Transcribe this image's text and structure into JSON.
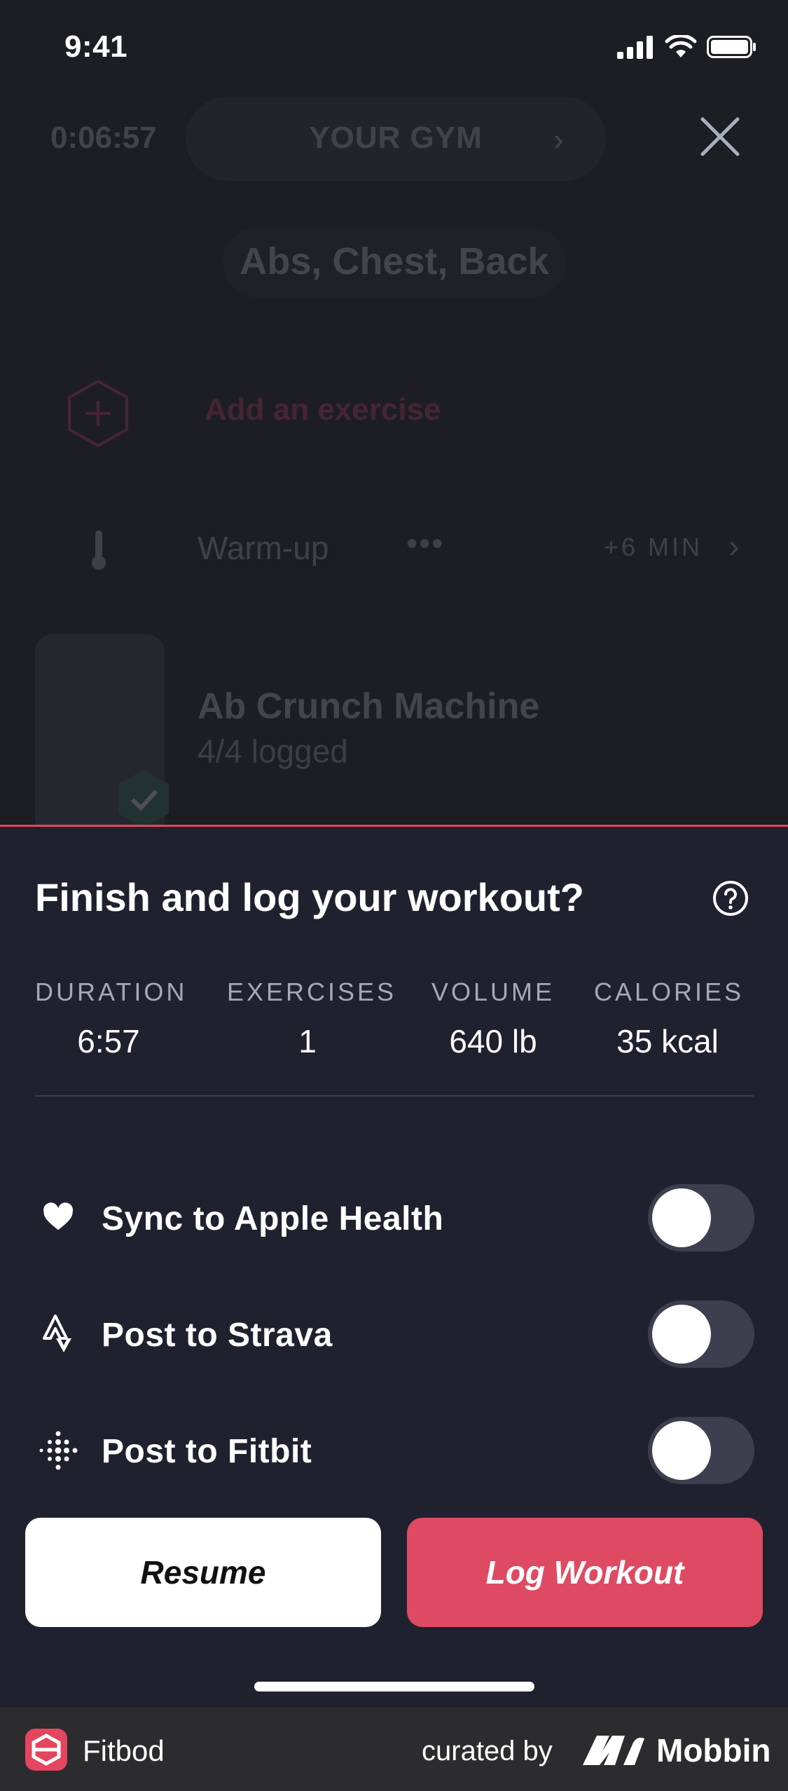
{
  "status_bar": {
    "time": "9:41"
  },
  "workout": {
    "timer": "0:06:57",
    "gym": "YOUR GYM",
    "muscle_groups": "Abs, Chest, Back",
    "add_exercise": "Add an exercise",
    "warmup": {
      "label": "Warm-up",
      "more": "•••",
      "duration": "+6 MIN"
    },
    "exercise": {
      "name": "Ab Crunch Machine",
      "logged": "4/4 logged"
    }
  },
  "sheet": {
    "title": "Finish and log your workout?",
    "stats": [
      {
        "label": "DURATION",
        "value": "6:57"
      },
      {
        "label": "EXERCISES",
        "value": "1"
      },
      {
        "label": "VOLUME",
        "value": "640 lb"
      },
      {
        "label": "CALORIES",
        "value": "35 kcal"
      }
    ],
    "toggles": [
      {
        "label": "Sync to Apple Health",
        "icon": "heart-icon",
        "on": false
      },
      {
        "label": "Post to Strava",
        "icon": "strava-icon",
        "on": false
      },
      {
        "label": "Post to Fitbit",
        "icon": "fitbit-icon",
        "on": false
      }
    ],
    "resume_label": "Resume",
    "log_label": "Log Workout"
  },
  "footer": {
    "app_name": "Fitbod",
    "curated_by": "curated by",
    "brand": "Mobbin"
  },
  "colors": {
    "accent": "#df4a63",
    "sheet_bg": "#20212e",
    "toggle_off": "#3d3f4e"
  }
}
